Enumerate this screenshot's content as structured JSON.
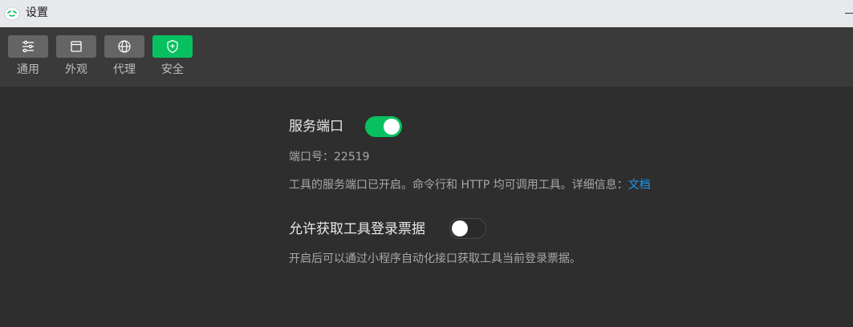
{
  "window": {
    "title": "设置",
    "app_icon": "wechat-devtools-icon",
    "minimize_icon": "minimize-icon"
  },
  "toolbar": {
    "tabs": [
      {
        "label": "通用",
        "icon": "sliders-icon",
        "active": false
      },
      {
        "label": "外观",
        "icon": "window-icon",
        "active": false
      },
      {
        "label": "代理",
        "icon": "globe-icon",
        "active": false
      },
      {
        "label": "安全",
        "icon": "shield-icon",
        "active": true
      }
    ]
  },
  "settings": {
    "service_port": {
      "title": "服务端口",
      "enabled": true,
      "port_label": "端口号：22519",
      "description": "工具的服务端口已开启。命令行和 HTTP 均可调用工具。详细信息：",
      "link_text": "文档"
    },
    "allow_ticket": {
      "title": "允许获取工具登录票据",
      "enabled": false,
      "description": "开启后可以通过小程序自动化接口获取工具当前登录票据。"
    }
  },
  "colors": {
    "accent": "#07c160",
    "link": "#1c9cf0",
    "background": "#2e2e2e",
    "toolbar": "#3a3a3a"
  }
}
